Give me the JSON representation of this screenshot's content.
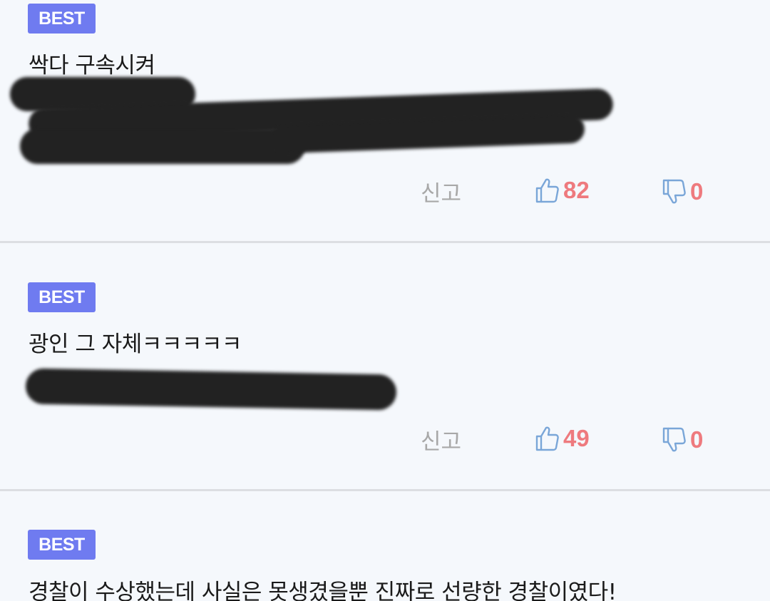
{
  "comments": [
    {
      "badge": "BEST",
      "text": "싹다 구속시켜",
      "report_label": "신고",
      "likes": "82",
      "dislikes": "0"
    },
    {
      "badge": "BEST",
      "text": "광인 그 자체ㅋㅋㅋㅋㅋ",
      "report_label": "신고",
      "likes": "49",
      "dislikes": "0"
    },
    {
      "badge": "BEST",
      "text": "경찰이 수상했는데 사실은 못생겼을뿐 진짜로 선량한 경찰이였다!"
    }
  ],
  "icons": {
    "like": "thumbs-up-icon",
    "dislike": "thumbs-down-icon"
  },
  "colors": {
    "background": "#f5f8fc",
    "badge": "#6f7bf0",
    "count": "#ee7a7e",
    "icon": "#7aa6d8",
    "report": "#a8a8a8"
  }
}
